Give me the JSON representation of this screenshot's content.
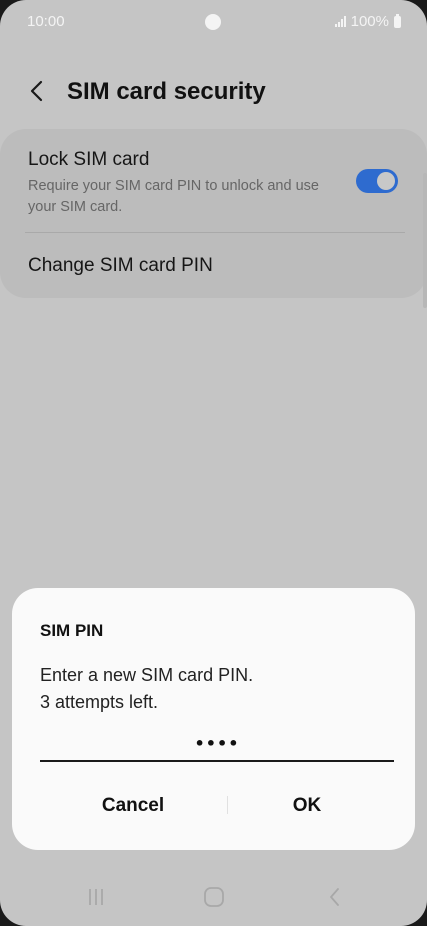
{
  "status_bar": {
    "time": "10:00",
    "battery_text": "100%"
  },
  "header": {
    "title": "SIM card security",
    "back_icon": "chevron-left-icon"
  },
  "settings": {
    "lock_sim": {
      "title": "Lock SIM card",
      "description": "Require your SIM card PIN to unlock and use your SIM card.",
      "toggle_on": true
    },
    "change_pin": {
      "title": "Change SIM card PIN"
    }
  },
  "dialog": {
    "title": "SIM PIN",
    "message_line1": "Enter a new SIM card PIN.",
    "message_line2": "3 attempts left.",
    "pin_value": "••••",
    "cancel_label": "Cancel",
    "ok_label": "OK"
  },
  "nav_bar": {
    "recents_icon": "recents-icon",
    "home_icon": "home-icon",
    "back_icon": "back-icon"
  },
  "colors": {
    "background": "#c5c5c5",
    "card": "#bcbcbc",
    "toggle_accent": "#2e6bcf",
    "dialog": "#fafafa"
  }
}
